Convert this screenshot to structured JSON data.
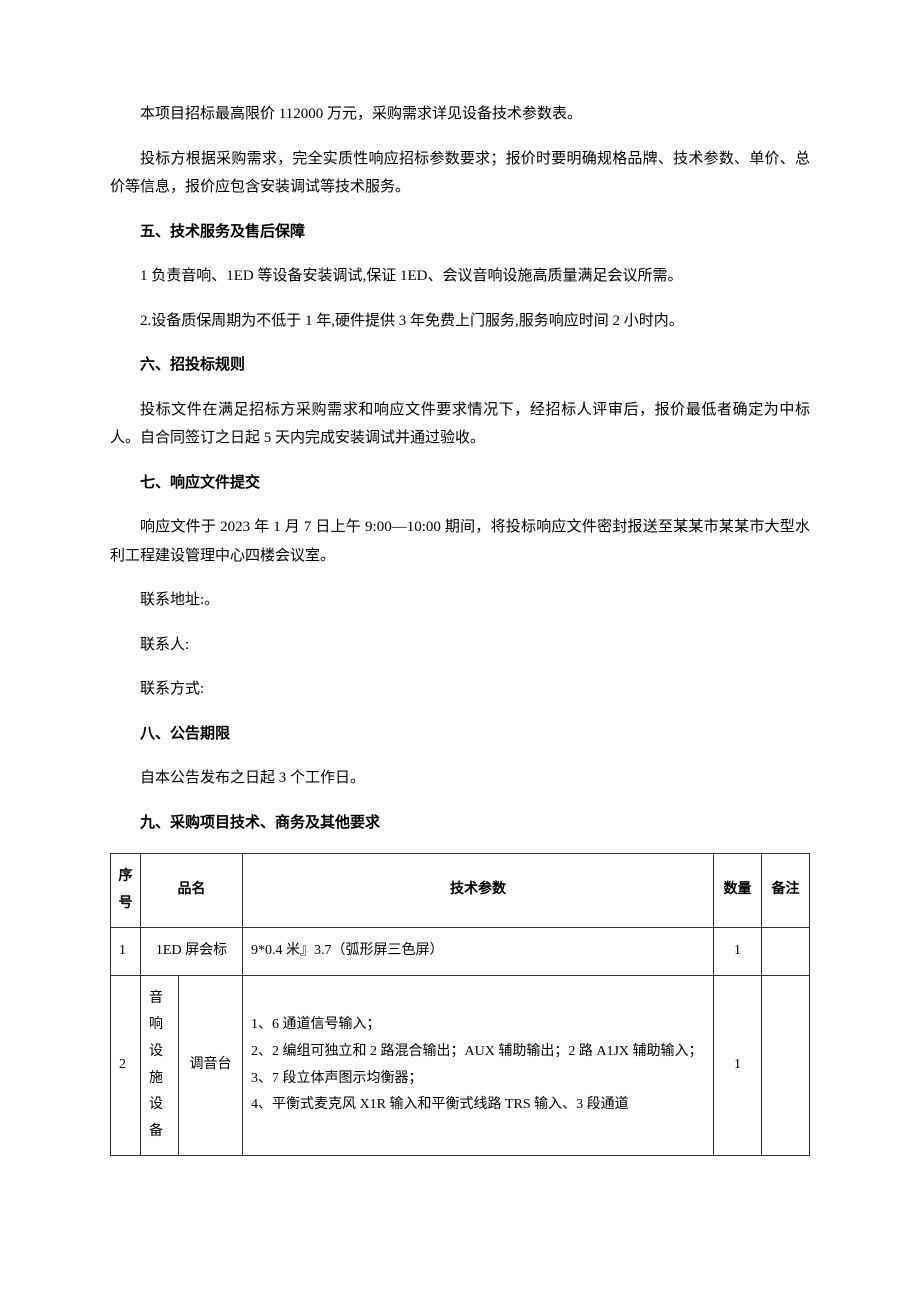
{
  "paras": {
    "p1": "本项目招标最高限价 112000 万元，采购需求详见设备技术参数表。",
    "p2": "投标方根据采购需求，完全实质性响应招标参数要求；报价时要明确规格品牌、技术参数、单价、总价等信息，报价应包含安装调试等技术服务。",
    "h5": "五、技术服务及售后保障",
    "p5_1": "1 负责音响、1ED 等设备安装调试,保证 1ED、会议音响设施高质量满足会议所需。",
    "p5_2": "2.设备质保周期为不低于 1 年,硬件提供 3 年免费上门服务,服务响应时间 2 小时内。",
    "h6": "六、招投标规则",
    "p6": "投标文件在满足招标方采购需求和响应文件要求情况下，经招标人评审后，报价最低者确定为中标人。自合同签订之日起 5 天内完成安装调试并通过验收。",
    "h7": "七、响应文件提交",
    "p7_1": "响应文件于 2023 年 1 月 7 日上午 9:00—10:00 期间，将投标响应文件密封报送至某某市某某市大型水利工程建设管理中心四楼会议室。",
    "p7_2": "联系地址:。",
    "p7_3": "联系人:",
    "p7_4": "联系方式:",
    "h8": "八、公告期限",
    "p8": "自本公告发布之日起 3 个工作日。",
    "h9": "九、采购项目技术、商务及其他要求"
  },
  "table": {
    "headers": {
      "seq": "序号",
      "name": "品名",
      "tech": "技术参数",
      "qty": "数量",
      "note": "备注"
    },
    "rows": [
      {
        "seq": "1",
        "name_full": "1ED 屏会标",
        "tech": "9*0.4 米』3.7（弧形屏三色屏）",
        "qty": "1",
        "note": ""
      },
      {
        "seq": "2",
        "name_group": "音响设施设备",
        "name_sub": "调音台",
        "tech": "1、6 通道信号输入；\n2、2 编组可独立和 2 路混合输出；AUX 辅助输出；2 路 A1JX 辅助输入；\n3、7 段立体声图示均衡器；\n4、平衡式麦克风 X1R 输入和平衡式线路 TRS 输入、3 段通道",
        "qty": "1",
        "note": ""
      }
    ]
  }
}
